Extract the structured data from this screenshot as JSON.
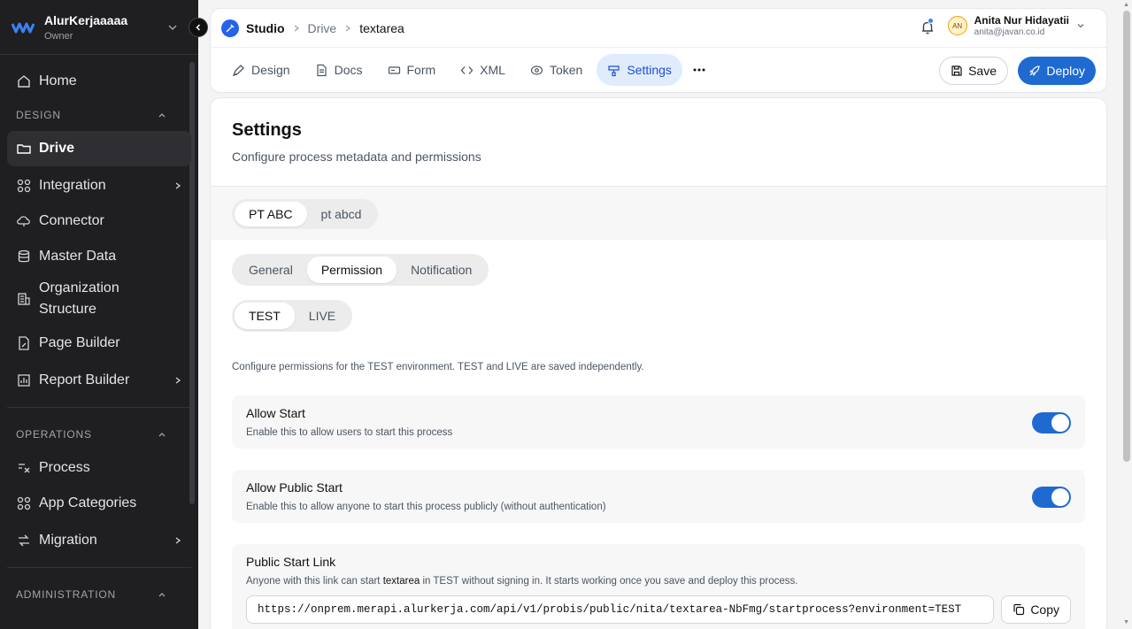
{
  "sidebar": {
    "brand_name": "AlurKerjaaaaa",
    "brand_role": "Owner",
    "home": "Home",
    "design_section": "DESIGN",
    "design_items": [
      {
        "label": "Drive",
        "icon": "folder-icon"
      },
      {
        "label": "Integration",
        "icon": "integration-icon"
      },
      {
        "label": "Connector",
        "icon": "connector-icon"
      },
      {
        "label": "Master Data",
        "icon": "database-icon"
      },
      {
        "label": "Organization Structure",
        "icon": "org-icon"
      },
      {
        "label": "Page Builder",
        "icon": "page-icon"
      },
      {
        "label": "Report Builder",
        "icon": "report-icon"
      }
    ],
    "operations_section": "OPERATIONS",
    "operations_items": [
      {
        "label": "Process",
        "icon": "process-icon"
      },
      {
        "label": "App Categories",
        "icon": "grid-icon"
      },
      {
        "label": "Migration",
        "icon": "migration-icon"
      }
    ],
    "administration_section": "ADMINISTRATION"
  },
  "topbar": {
    "breadcrumb": [
      "Studio",
      "Drive",
      "textarea"
    ],
    "user_initials": "AN",
    "user_name": "Anita Nur Hidayatii",
    "user_email": "anita@javan.co.id"
  },
  "tabs": [
    {
      "label": "Design",
      "icon": "design-icon"
    },
    {
      "label": "Docs",
      "icon": "docs-icon"
    },
    {
      "label": "Form",
      "icon": "form-icon"
    },
    {
      "label": "XML",
      "icon": "code-icon"
    },
    {
      "label": "Token",
      "icon": "token-icon"
    },
    {
      "label": "Settings",
      "icon": "settings-icon",
      "active": true
    }
  ],
  "actions": {
    "save": "Save",
    "deploy": "Deploy"
  },
  "settings": {
    "title": "Settings",
    "subtitle": "Configure process metadata and permissions",
    "companies": [
      "PT ABC",
      "pt abcd"
    ],
    "subtabs": [
      "General",
      "Permission",
      "Notification"
    ],
    "environments": [
      "TEST",
      "LIVE"
    ],
    "env_note": "Configure permissions for the TEST environment. TEST and LIVE are saved independently.",
    "allow_start": {
      "title": "Allow Start",
      "desc": "Enable this to allow users to start this process",
      "enabled": true
    },
    "allow_public_start": {
      "title": "Allow Public Start",
      "desc": "Enable this to allow anyone to start this process publicly (without authentication)",
      "enabled": true
    },
    "public_link": {
      "title": "Public Start Link",
      "desc_prefix": "Anyone with this link can start ",
      "desc_process": "textarea",
      "desc_suffix": " in TEST without signing in. It starts working once you save and deploy this process.",
      "url": "https://onprem.merapi.alurkerja.com/api/v1/probis/public/nita/textarea-NbFmg/startprocess?environment=TEST",
      "copy": "Copy"
    }
  },
  "colors": {
    "accent": "#1f6ad1",
    "sidebar_bg": "#1f1f22",
    "active_tab_bg": "#e0ecfb"
  }
}
